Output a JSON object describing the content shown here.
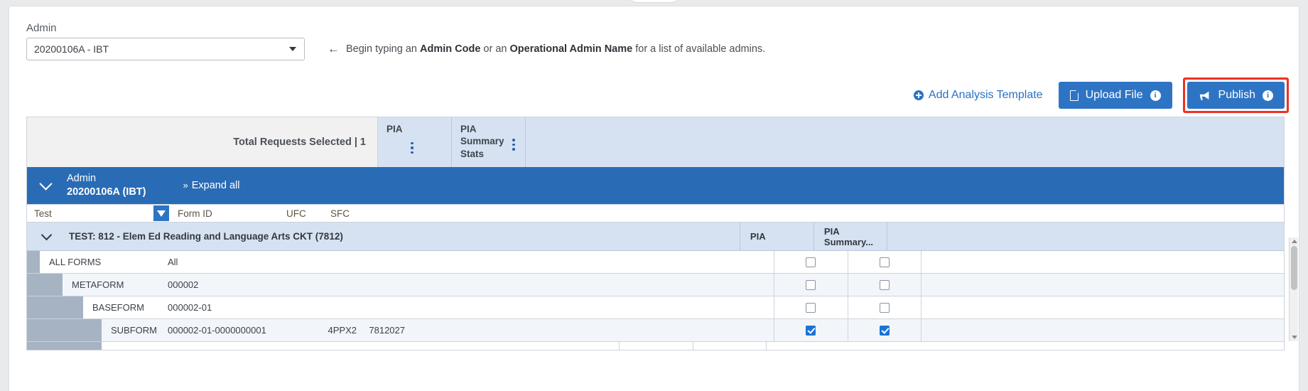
{
  "admin_section": {
    "label": "Admin",
    "selected_value": "20200106A - IBT",
    "hint_arrow": "←",
    "hint_prefix": "Begin typing an ",
    "hint_bold1": "Admin Code",
    "hint_mid": " or an ",
    "hint_bold2": "Operational Admin Name",
    "hint_suffix": " for a list of available admins."
  },
  "toolbar": {
    "add_analysis_template": "Add Analysis Template",
    "upload_file": "Upload File",
    "publish": "Publish",
    "info_glyph": "i",
    "accent_color": "#2e74c4",
    "highlight_color": "#ee3124"
  },
  "grid": {
    "summary_header": {
      "total_requests_label": "Total Requests Selected  |  1",
      "pia_column": "PIA",
      "pia_summary_column": "PIA Summary Stats"
    },
    "admin_band": {
      "line1": "Admin",
      "line2": "20200106A (IBT)",
      "expand_all": "Expand all",
      "expand_chevron": "»",
      "band_color": "#2a6bb5"
    },
    "columns": {
      "test": "Test",
      "form_id": "Form ID",
      "ufc": "UFC",
      "sfc": "SFC"
    },
    "test_group": {
      "title": "TEST: 812 - Elem Ed Reading and Language Arts CKT (7812)",
      "pia": "PIA",
      "pia_summary": "PIA Summary..."
    },
    "rows": [
      {
        "level": 0,
        "type": "ALL FORMS",
        "form_id": "All",
        "ufc": "",
        "sfc": "",
        "pia_checked": false,
        "pia_summary_checked": false
      },
      {
        "level": 1,
        "type": "METAFORM",
        "form_id": "000002",
        "ufc": "",
        "sfc": "",
        "pia_checked": false,
        "pia_summary_checked": false
      },
      {
        "level": 2,
        "type": "BASEFORM",
        "form_id": "000002-01",
        "ufc": "",
        "sfc": "",
        "pia_checked": false,
        "pia_summary_checked": false
      },
      {
        "level": 3,
        "type": "SUBFORM",
        "form_id": "000002-01-0000000001",
        "ufc": "4PPX2",
        "sfc": "7812027",
        "pia_checked": true,
        "pia_summary_checked": true
      }
    ]
  }
}
